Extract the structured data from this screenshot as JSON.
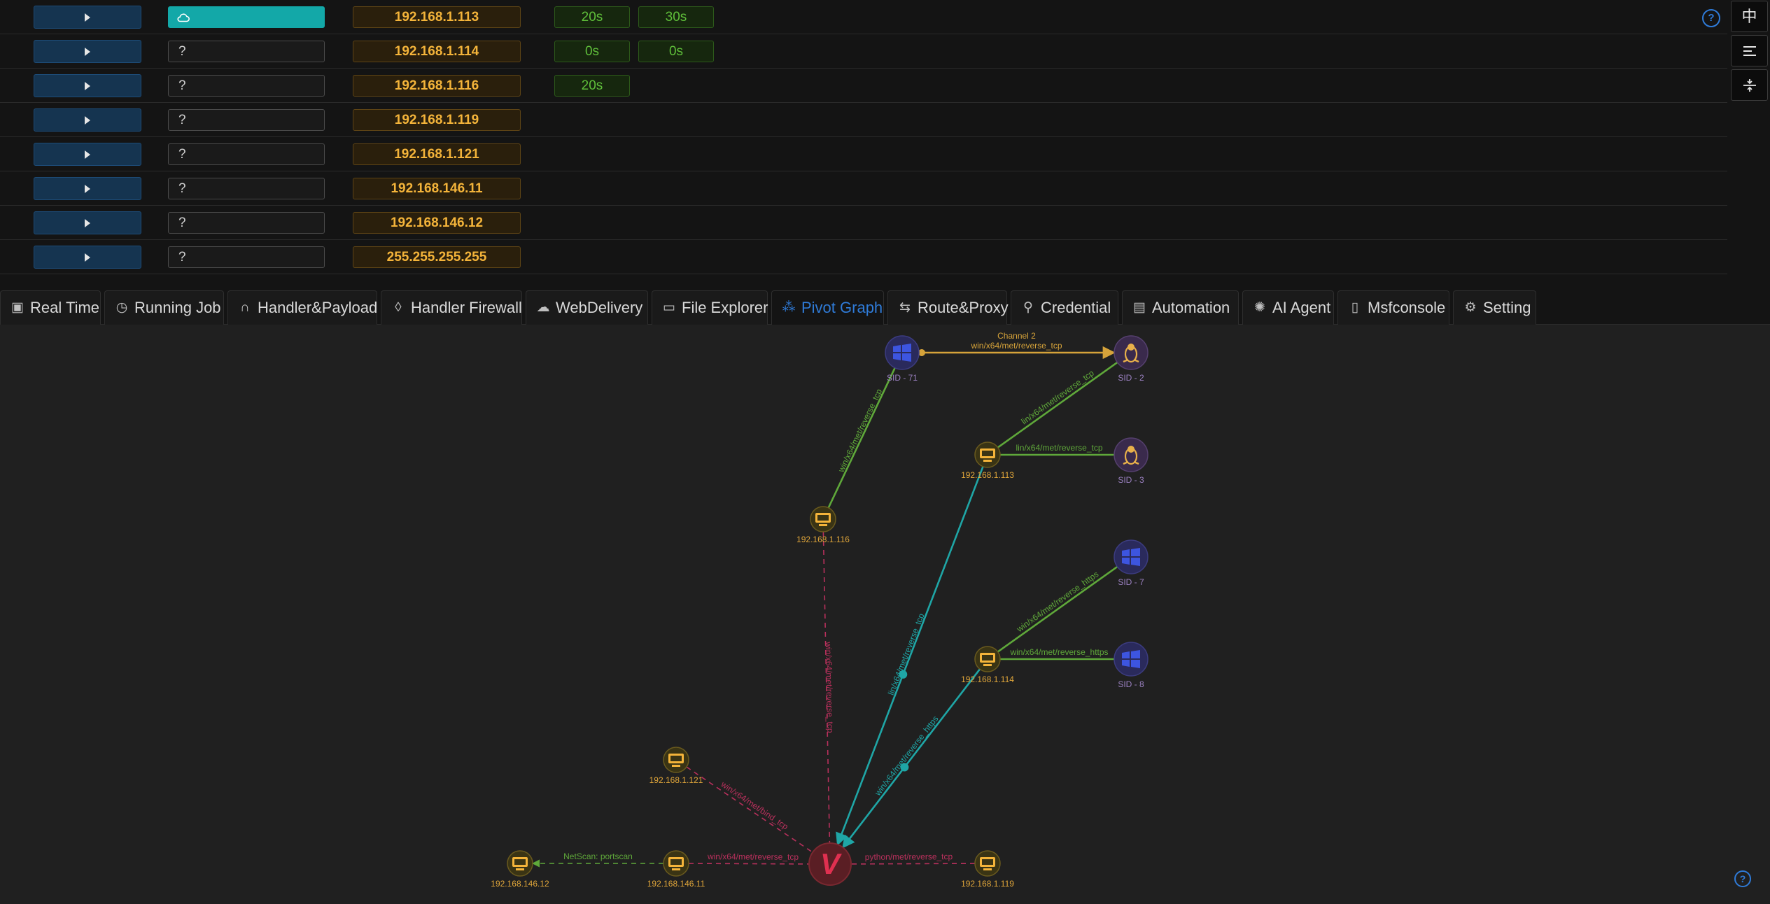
{
  "hosts": [
    {
      "platform": "",
      "platform_icon": "cloud-icon",
      "active": true,
      "ip": "192.168.1.113",
      "times": [
        "20s",
        "30s"
      ]
    },
    {
      "platform": "?",
      "active": false,
      "ip": "192.168.1.114",
      "times": [
        "0s",
        "0s"
      ]
    },
    {
      "platform": "?",
      "active": false,
      "ip": "192.168.1.116",
      "times": [
        "20s"
      ]
    },
    {
      "platform": "?",
      "active": false,
      "ip": "192.168.1.119",
      "times": []
    },
    {
      "platform": "?",
      "active": false,
      "ip": "192.168.1.121",
      "times": []
    },
    {
      "platform": "?",
      "active": false,
      "ip": "192.168.146.11",
      "times": []
    },
    {
      "platform": "?",
      "active": false,
      "ip": "192.168.146.12",
      "times": []
    },
    {
      "platform": "?",
      "active": false,
      "ip": "255.255.255.255",
      "times": []
    }
  ],
  "help": "?",
  "rail": {
    "lang": "中",
    "menu_icon": "align-left-icon",
    "split_icon": "split-vertical-icon"
  },
  "tabs": [
    {
      "label": "Real Time",
      "icon": "dashboard-icon"
    },
    {
      "label": "Running Job",
      "icon": "clock-icon"
    },
    {
      "label": "Handler&Payload",
      "icon": "headphones-icon"
    },
    {
      "label": "Handler Firewall",
      "icon": "fire-icon"
    },
    {
      "label": "WebDelivery",
      "icon": "cloud-upload-icon"
    },
    {
      "label": "File Explorer",
      "icon": "folder-open-icon"
    },
    {
      "label": "Pivot Graph",
      "icon": "graph-icon",
      "active": true
    },
    {
      "label": "Route&Proxy",
      "icon": "route-icon"
    },
    {
      "label": "Credential",
      "icon": "key-search-icon"
    },
    {
      "label": "Automation",
      "icon": "robot-icon"
    },
    {
      "label": "AI Agent",
      "icon": "ai-icon"
    },
    {
      "label": "Msfconsole",
      "icon": "terminal-icon"
    },
    {
      "label": "Setting",
      "icon": "gear-icon"
    }
  ],
  "graph": {
    "center": {
      "id": "viper",
      "label": "V"
    },
    "nodes": [
      {
        "id": "sid71",
        "kind": "windows",
        "label": "SID - 71"
      },
      {
        "id": "sid2",
        "kind": "linux",
        "label": "SID - 2"
      },
      {
        "id": "h113",
        "kind": "host",
        "label": "192.168.1.113"
      },
      {
        "id": "sid3",
        "kind": "linux",
        "label": "SID - 3"
      },
      {
        "id": "h116",
        "kind": "host",
        "label": "192.168.1.116"
      },
      {
        "id": "sid7",
        "kind": "windows",
        "label": "SID - 7"
      },
      {
        "id": "h114",
        "kind": "host",
        "label": "192.168.1.114"
      },
      {
        "id": "sid8",
        "kind": "windows",
        "label": "SID - 8"
      },
      {
        "id": "h121",
        "kind": "host",
        "label": "192.168.1.121"
      },
      {
        "id": "h146_12",
        "kind": "host",
        "label": "192.168.146.12"
      },
      {
        "id": "h146_11",
        "kind": "host",
        "label": "192.168.146.11"
      },
      {
        "id": "h119",
        "kind": "host",
        "label": "192.168.1.119"
      }
    ],
    "edges": [
      {
        "from": "sid71",
        "to": "sid2",
        "label": "win/x64/met/reverse_tcp",
        "label2": "Channel 2",
        "color": "#d6a33a",
        "style": "solid-arrow"
      },
      {
        "from": "h116",
        "to": "sid71",
        "label": "win/x64/met/reverse_tcp",
        "color": "#5fa83a",
        "style": "solid"
      },
      {
        "from": "h113",
        "to": "sid2",
        "label": "lin/x64/met/reverse_tcp",
        "color": "#5fa83a",
        "style": "solid"
      },
      {
        "from": "h113",
        "to": "sid3",
        "label": "lin/x64/met/reverse_tcp",
        "color": "#5fa83a",
        "style": "solid"
      },
      {
        "from": "h114",
        "to": "sid7",
        "label": "win/x64/met/reverse_https",
        "color": "#5fa83a",
        "style": "solid"
      },
      {
        "from": "h114",
        "to": "sid8",
        "label": "win/x64/met/reverse_https",
        "color": "#5fa83a",
        "style": "solid"
      },
      {
        "from": "h113",
        "to": "viper",
        "label": "lin/x64/met/reverse_tcp",
        "color": "#1fa6a6",
        "style": "solid-arrow"
      },
      {
        "from": "h114",
        "to": "viper",
        "label": "win/x64/met/reverse_https",
        "color": "#1fa6a6",
        "style": "solid-arrow"
      },
      {
        "from": "h116",
        "to": "viper",
        "label": "win/x64/met/reverse_tcp",
        "color": "#b8305c",
        "style": "dashed"
      },
      {
        "from": "h121",
        "to": "viper",
        "label": "win/x64/met/bind_tcp",
        "color": "#b8305c",
        "style": "dashed"
      },
      {
        "from": "h146_11",
        "to": "viper",
        "label": "win/x64/met/reverse_tcp",
        "color": "#b8305c",
        "style": "dashed"
      },
      {
        "from": "h119",
        "to": "viper",
        "label": "python/met/reverse_tcp",
        "color": "#b8305c",
        "style": "dashed"
      },
      {
        "from": "h146_11",
        "to": "h146_12",
        "label": "NetScan: portscan",
        "color": "#5fa83a",
        "style": "dashed-arrow"
      }
    ]
  },
  "colors": {
    "accent": "#2f7bd8",
    "ip": "#f4b43a",
    "teal": "#13a8a8",
    "green": "#5fbf3a",
    "viper": "#e03050"
  }
}
